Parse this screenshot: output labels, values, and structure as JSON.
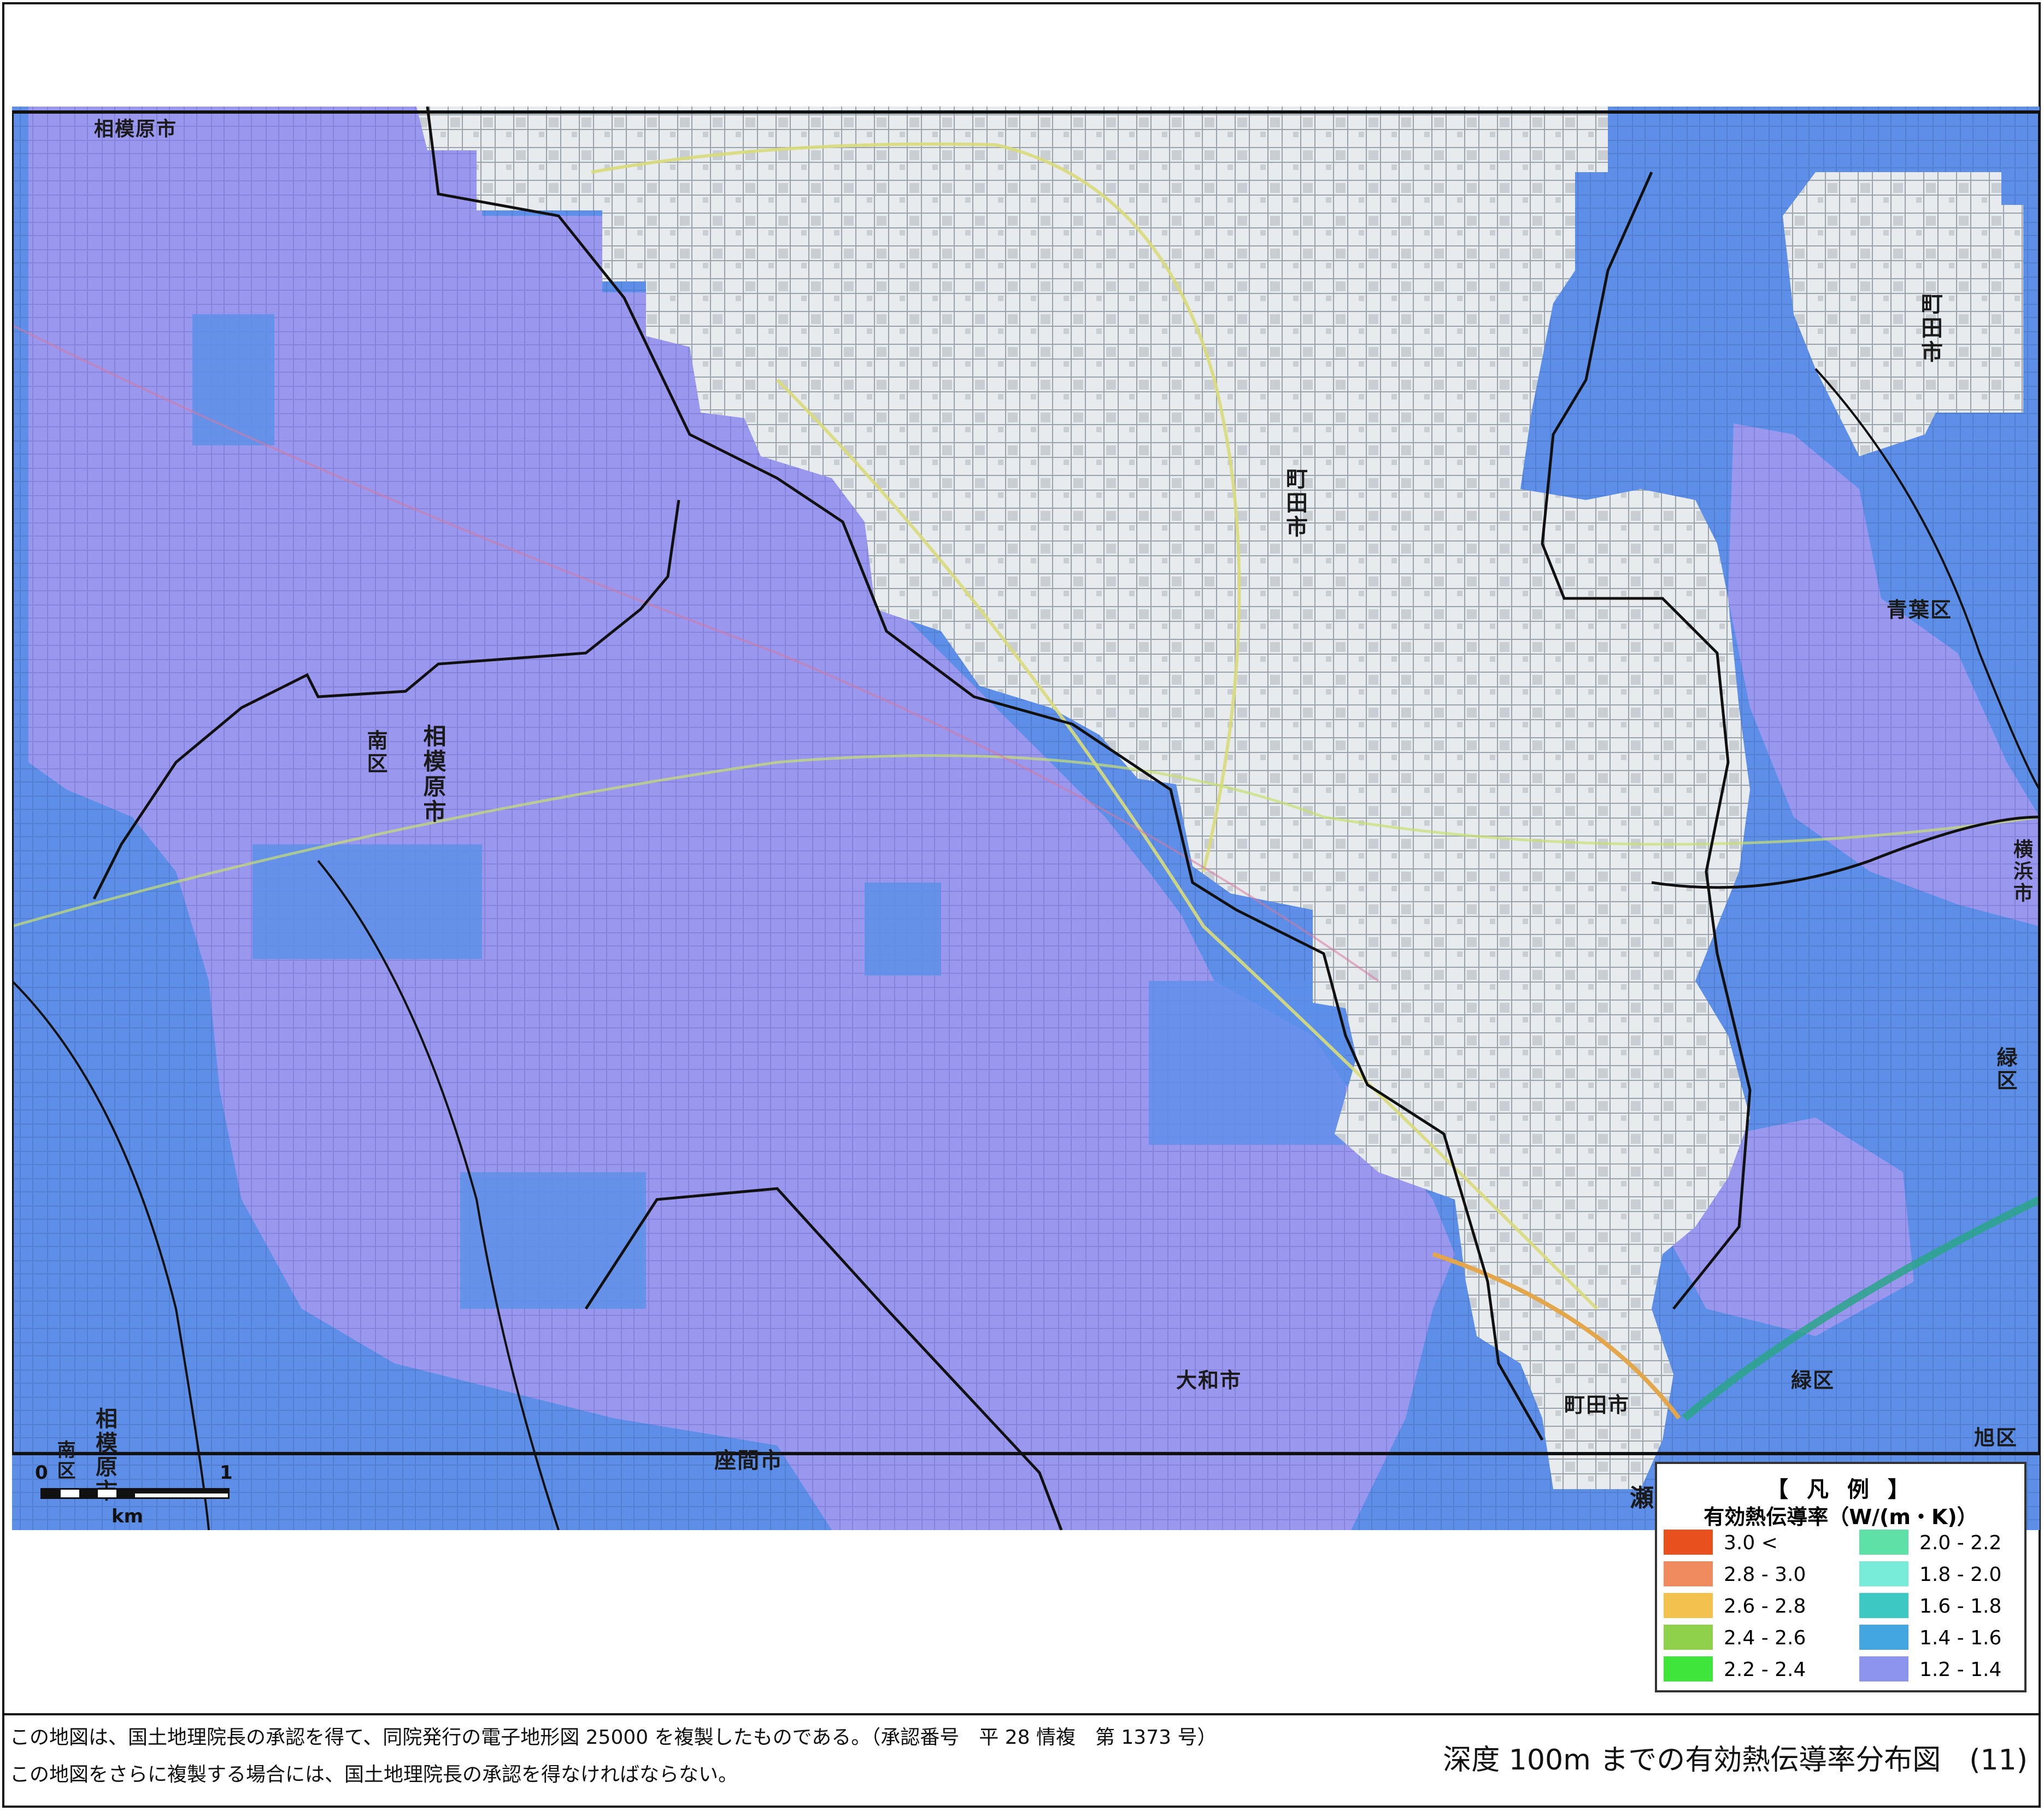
{
  "map": {
    "city_labels": {
      "sagamihara_top": "相模原市",
      "minami_ku": "南区",
      "sagamihara_mid": "相模原市",
      "machida_right": "町田市",
      "machida_center": "町田市",
      "aoba_ku": "青葉区",
      "yokohama_shi": "横浜市",
      "midori_ku_right": "緑区",
      "midori_ku_bottom": "緑区",
      "yamato_shi": "大和市",
      "machida_bottom": "町田市",
      "zama_shi": "座間市",
      "sagamihara_bottom": "相模原市",
      "minami_ku_bottom": "南区",
      "asahi_ku": "旭区",
      "seya": "瀬"
    },
    "colors": {
      "background_blue": "#5d8fe8",
      "lavender": "#9a97ee",
      "base_map": "#e9ecef",
      "boundary": "#111111"
    },
    "scale_bar": {
      "start": "0",
      "end": "1",
      "unit": "km"
    }
  },
  "legend": {
    "title": "【 凡 例 】",
    "subtitle": "有効熱伝導率（W/(m・K)）",
    "left_items": [
      {
        "label": "3.0 <",
        "color": "#e8501e"
      },
      {
        "label": "2.8 - 3.0",
        "color": "#ef8b5e"
      },
      {
        "label": "2.6 - 2.8",
        "color": "#f2c14e"
      },
      {
        "label": "2.4 - 2.6",
        "color": "#8fd14a"
      },
      {
        "label": "2.2 - 2.4",
        "color": "#3fe53a"
      }
    ],
    "right_items": [
      {
        "label": "2.0 - 2.2",
        "color": "#5fe0a6"
      },
      {
        "label": "1.8 - 2.0",
        "color": "#78ecd8"
      },
      {
        "label": "1.6 - 1.8",
        "color": "#3dc8c4"
      },
      {
        "label": "1.4 - 1.6",
        "color": "#44a6e0"
      },
      {
        "label": "1.2 - 1.4",
        "color": "#8c94ee"
      }
    ]
  },
  "footer": {
    "note_line1": "この地図は、国土地理院長の承認を得て、同院発行の電子地形図 25000 を複製したものである。（承認番号　平 28 情複　第 1373 号）",
    "note_line2": "この地図をさらに複製する場合には、国土地理院長の承認を得なければならない。",
    "map_title": "深度 100m までの有効熱伝導率分布図　(11)"
  }
}
